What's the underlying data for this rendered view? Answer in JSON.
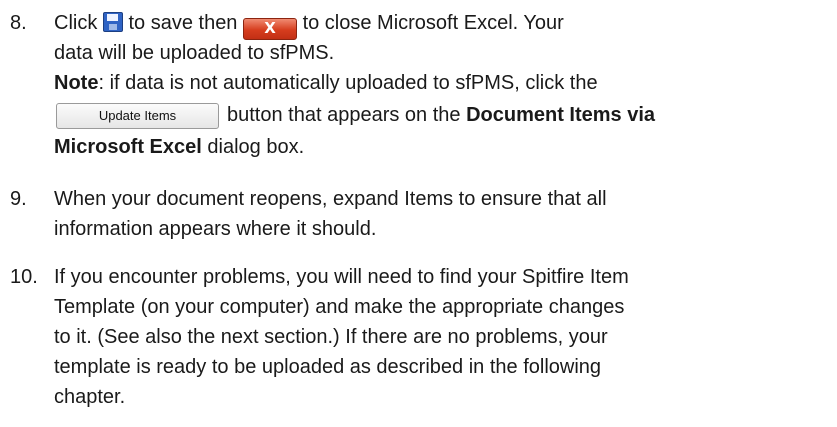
{
  "steps": [
    {
      "number": "8.",
      "l1a": "Click",
      "save_icon": "save-icon",
      "l1b": "to save then",
      "close_icon": "close-x-icon",
      "close_glyph": "X",
      "l1c": "to close Microsoft Excel.  Your",
      "l2": "data will be uploaded to sfPMS.",
      "note_label": "Note",
      "note_text": ": if data is not automatically uploaded to sfPMS, click the",
      "update_button": "Update Items",
      "l4a": "button that appears on the",
      "l4b": "Document Items via",
      "l5a": "Microsoft Excel",
      "l5b": "dialog box."
    },
    {
      "number": "9.",
      "lines": [
        "When your document reopens, expand Items to ensure that all",
        "information appears where it should."
      ]
    },
    {
      "number": "10.",
      "lines": [
        "If you encounter problems, you will need to find your Spitfire Item",
        "Template (on your computer) and make the appropriate changes",
        "to it. (See also the next section.) If there are no problems, your",
        "template is ready to be uploaded as described in the following",
        "chapter."
      ]
    }
  ]
}
